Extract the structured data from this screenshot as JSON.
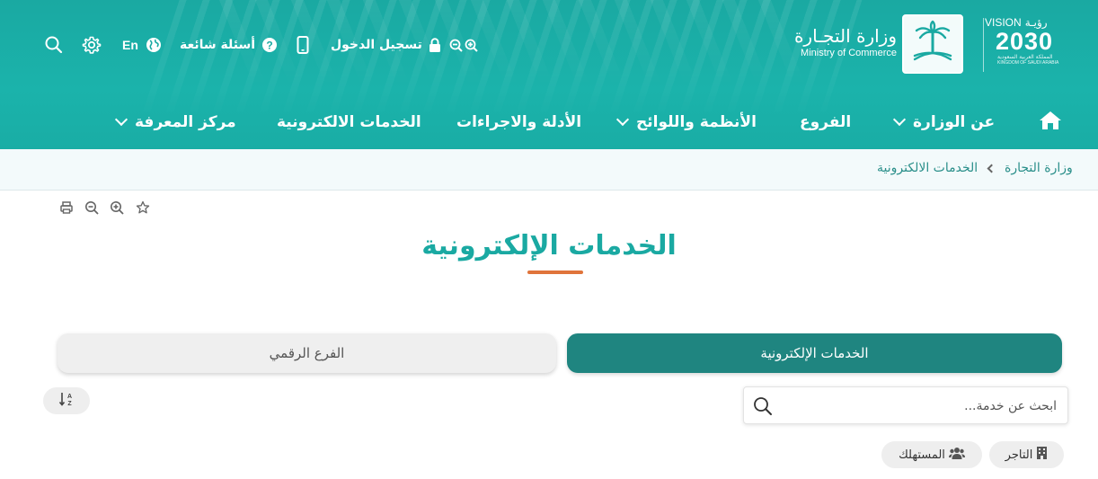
{
  "header": {
    "vision": {
      "label": "VISION",
      "ar_label": "رؤيـة",
      "year": "2030",
      "kingdom_ar": "المملكة العربية السعودية",
      "kingdom_en": "KINGDOM OF SAUDI ARABIA"
    },
    "ministry_ar": "وزارة التجـارة",
    "ministry_en": "Ministry of Commerce",
    "utility": {
      "login": "تسجيل الدخول",
      "faq": "أسئلة شائعة",
      "lang": "En"
    },
    "nav": {
      "about": "عن الوزارة",
      "branches": "الفروع",
      "regulations": "الأنظمة واللوائح",
      "guides": "الأدلة والاجراءات",
      "eservices": "الخدمات الالكترونية",
      "knowledge": "مركز المعرفة"
    }
  },
  "breadcrumb": {
    "home": "وزارة التجارة",
    "current": "الخدمات الالكترونية"
  },
  "page": {
    "title": "الخدمات الإلكترونية"
  },
  "tabs": {
    "eservices": "الخدمات الإلكترونية",
    "digital_branch": "الفرع الرقمي"
  },
  "search": {
    "placeholder": "ابحث عن خدمة..."
  },
  "filters": {
    "merchant": "التاجر",
    "consumer": "المستهلك"
  },
  "colors": {
    "header_teal": "#1aa9a2",
    "active_tab": "#1f8580",
    "title_teal": "#1aa9a2",
    "accent_orange": "#e0743b"
  },
  "icons": {
    "home": "home-icon",
    "search": "search-icon",
    "settings": "gear-icon",
    "globe": "globe-icon",
    "faq": "question-icon",
    "mobile": "mobile-icon",
    "lock": "lock-icon",
    "zoom_out": "zoom-out-icon",
    "zoom_in": "zoom-in-icon",
    "print": "print-icon",
    "star": "star-icon",
    "sort": "sort-az-icon",
    "building": "building-icon",
    "users": "users-icon"
  }
}
